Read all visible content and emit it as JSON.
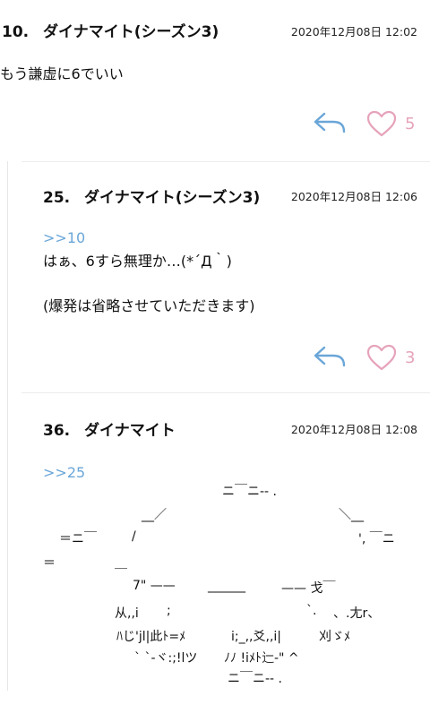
{
  "posts": [
    {
      "number": "10.",
      "name": "ダイナマイト(シーズン3)",
      "date": "2020年12月08日 12:02",
      "body": "もう謙虚に6でいい",
      "likes": "5"
    },
    {
      "number": "25.",
      "name": "ダイナマイト(シーズン3)",
      "date": "2020年12月08日 12:06",
      "anchor": ">>10",
      "body_line1": "はぁ、6すら無理か…(*´Д｀)",
      "body_line2": "(爆発は省略させていただきます)",
      "likes": "3"
    },
    {
      "number": "36.",
      "name": "ダイナマイト",
      "date": "2020年12月08日 12:08",
      "anchor": ">>25",
      "ascii_art": [
        "ニ￣ニ-- .",
        "__／",
        "＼__",
        "＝ニ￣",
        "/",
        "', ￣ニ",
        "＝",
        "￣",
        "7\" ——",
        "______",
        "—— 戈￣",
        "从,,i",
        ";",
        "`.",
        "、.尢r、",
        "ﾊじ'jl|此ﾄ=ﾒ",
        "i;_,,爻,,i|",
        "刈ゞﾒ",
        "` `-ヾ:;!lツ",
        "ﾉﾉ !iﾒﾄ辷-\" ^",
        "ニ￣ニ-- ."
      ]
    }
  ],
  "colors": {
    "accent_blue": "#6aa6d8",
    "heart_pink": "#e6a3bb"
  },
  "icons": {
    "reply": "reply-arrow-icon",
    "like": "heart-outline-icon"
  }
}
